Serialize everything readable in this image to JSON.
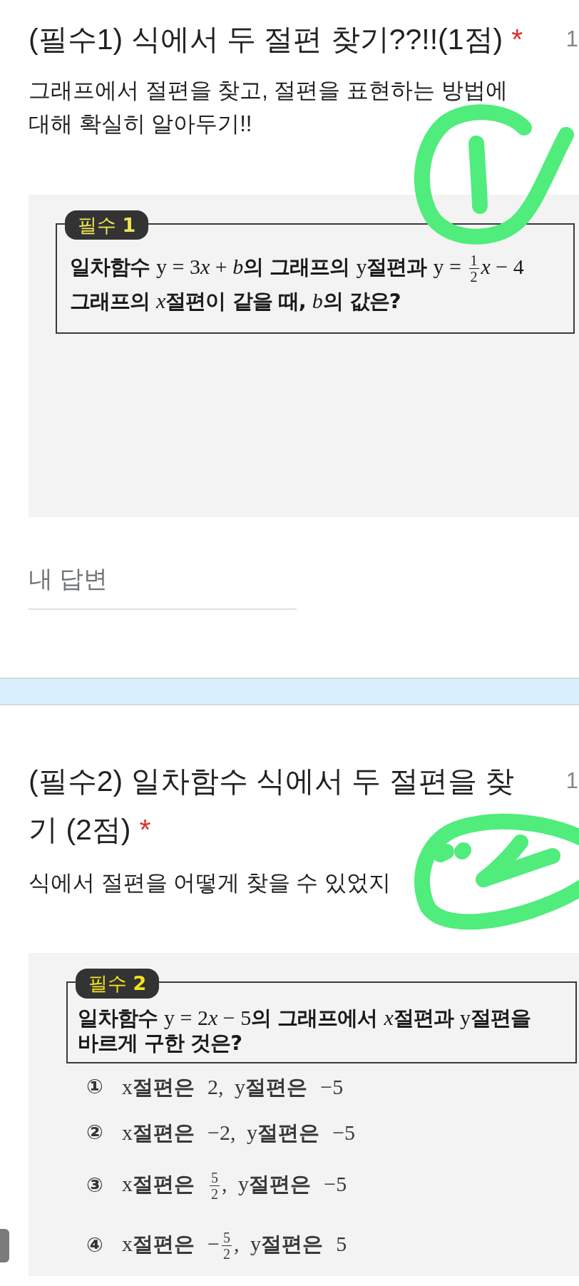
{
  "questions": [
    {
      "title": "(필수1) 식에서 두 절편 찾기??!!(1점)",
      "required_mark": "*",
      "points": "1",
      "description": "그래프에서 절편을 찾고, 절편을 표현하는 방법에 대해 확실히 알아두기!!",
      "image": {
        "badge": "필수 **1**",
        "problem_lines": [
          [
            {
              "kind": "text",
              "text": "일차함수 "
            },
            {
              "kind": "math",
              "text": "y = 3"
            },
            {
              "kind": "var",
              "text": "x"
            },
            {
              "kind": "math",
              "text": " + "
            },
            {
              "kind": "var",
              "text": "b"
            },
            {
              "kind": "text",
              "text": "의 그래프의 "
            },
            {
              "kind": "math",
              "text": "y"
            },
            {
              "kind": "text",
              "text": "절편과 "
            },
            {
              "kind": "math",
              "text": "y = "
            },
            {
              "kind": "fraction",
              "numerator": "1",
              "denominator": "2"
            },
            {
              "kind": "var",
              "text": "x"
            },
            {
              "kind": "math",
              "text": " − 4"
            }
          ],
          [
            {
              "kind": "text",
              "text": "그래프의 "
            },
            {
              "kind": "var",
              "text": "x"
            },
            {
              "kind": "text",
              "text": "절편이 같을 때, "
            },
            {
              "kind": "var",
              "text": "b"
            },
            {
              "kind": "text",
              "text": "의 값은?"
            }
          ]
        ]
      },
      "answer": {
        "placeholder": "내 답변"
      }
    },
    {
      "title": "(필수2) 일차함수 식에서 두 절편을 찾기 (2점)",
      "required_mark": "*",
      "points": "1",
      "description": "식에서 절편을 어떻게 찾을 수 있었지",
      "image": {
        "badge": "필수 **2**",
        "problem_lines": [
          [
            {
              "kind": "text",
              "text": "일차함수 "
            },
            {
              "kind": "math",
              "text": "y = 2"
            },
            {
              "kind": "var",
              "text": "x"
            },
            {
              "kind": "math",
              "text": " − 5"
            },
            {
              "kind": "text",
              "text": "의 그래프에서 "
            },
            {
              "kind": "var",
              "text": "x"
            },
            {
              "kind": "text",
              "text": "절편과 "
            },
            {
              "kind": "math",
              "text": "y"
            },
            {
              "kind": "text",
              "text": "절편을"
            }
          ],
          [
            {
              "kind": "text",
              "text": "바르게 구한 것은?"
            }
          ]
        ],
        "options": [
          {
            "number": "①",
            "segments": [
              {
                "kind": "math",
                "text": "x"
              },
              {
                "kind": "text",
                "text": "절편은 "
              },
              {
                "kind": "math",
                "text": "2, y"
              },
              {
                "kind": "text",
                "text": "절편은 "
              },
              {
                "kind": "math",
                "text": "−5"
              }
            ]
          },
          {
            "number": "②",
            "segments": [
              {
                "kind": "math",
                "text": "x"
              },
              {
                "kind": "text",
                "text": "절편은 "
              },
              {
                "kind": "math",
                "text": "−2, y"
              },
              {
                "kind": "text",
                "text": "절편은 "
              },
              {
                "kind": "math",
                "text": "−5"
              }
            ]
          },
          {
            "number": "③",
            "segments": [
              {
                "kind": "math",
                "text": "x"
              },
              {
                "kind": "text",
                "text": "절편은 "
              },
              {
                "kind": "fraction",
                "numerator": "5",
                "denominator": "2"
              },
              {
                "kind": "math",
                "text": ", y"
              },
              {
                "kind": "text",
                "text": "절편은 "
              },
              {
                "kind": "math",
                "text": "−5"
              }
            ]
          },
          {
            "number": "④",
            "segments": [
              {
                "kind": "math",
                "text": "x"
              },
              {
                "kind": "text",
                "text": "절편은 "
              },
              {
                "kind": "math",
                "text": "−"
              },
              {
                "kind": "fraction",
                "numerator": "5",
                "denominator": "2"
              },
              {
                "kind": "math",
                "text": ", y"
              },
              {
                "kind": "text",
                "text": "절편은 "
              },
              {
                "kind": "math",
                "text": "5"
              }
            ]
          }
        ]
      }
    }
  ]
}
